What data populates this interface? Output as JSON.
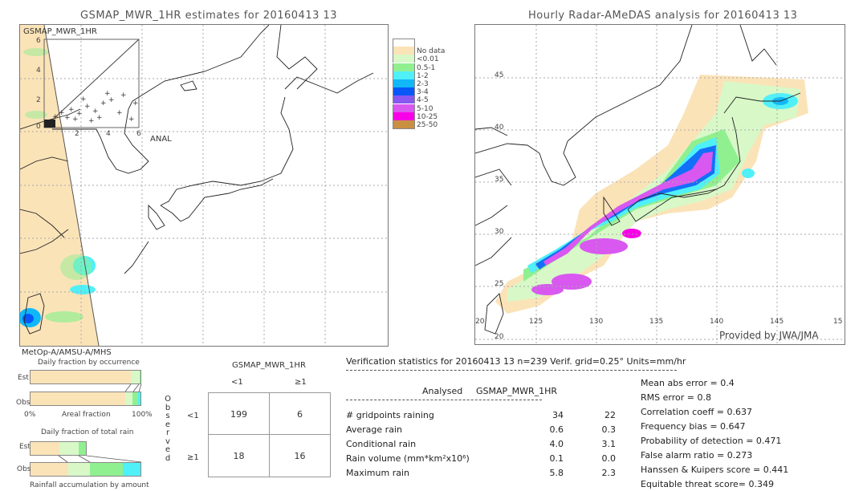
{
  "left_panel": {
    "title": "GSMAP_MWR_1HR estimates for 20160413 13",
    "inset_label": "GSMAP_MWR_1HR",
    "inset_y_ticks": [
      "6",
      "4",
      "2",
      "0"
    ],
    "inset_x_ticks": [
      "2",
      "4",
      "6"
    ],
    "anal_label": "ANAL",
    "satellite_label": "MetOp-A/AMSU-A/MHS"
  },
  "legend": {
    "items": [
      {
        "label": "",
        "color": "#ffffff"
      },
      {
        "label": "No data",
        "color": "#fbe3b8"
      },
      {
        "label": "<0.01",
        "color": "#d8f8c8"
      },
      {
        "label": "0.5-1",
        "color": "#90f090"
      },
      {
        "label": "1-2",
        "color": "#50f0f8"
      },
      {
        "label": "2-3",
        "color": "#10b8f8"
      },
      {
        "label": "3-4",
        "color": "#0858f8"
      },
      {
        "label": "4-5",
        "color": "#8858f0"
      },
      {
        "label": "5-10",
        "color": "#d858f0"
      },
      {
        "label": "10-25",
        "color": "#f800e8"
      },
      {
        "label": "25-50",
        "color": "#c89040"
      }
    ]
  },
  "right_panel": {
    "title": "Hourly Radar-AMeDAS analysis for 20160413 13",
    "lat_ticks": [
      "45",
      "40",
      "35",
      "30",
      "25",
      "20"
    ],
    "lon_ticks": [
      "20",
      "125",
      "130",
      "135",
      "140",
      "145",
      "15"
    ],
    "credit": "Provided by JWA/JMA"
  },
  "fraction_charts": {
    "occurrence_title": "Daily fraction by occurrence",
    "est_label": "Est",
    "obs_label": "Obs",
    "axis_left": "0%",
    "axis_mid": "Areal fraction",
    "axis_right": "100%",
    "occurrence_est": [
      {
        "color": "#fbe3b8",
        "fraction": 0.91
      },
      {
        "color": "#d8f8c8",
        "fraction": 0.08
      },
      {
        "color": "#90f090",
        "fraction": 0.01
      }
    ],
    "occurrence_obs": [
      {
        "color": "#fbe3b8",
        "fraction": 0.86
      },
      {
        "color": "#d8f8c8",
        "fraction": 0.07
      },
      {
        "color": "#90f090",
        "fraction": 0.05
      },
      {
        "color": "#50f0f8",
        "fraction": 0.02
      }
    ],
    "total_title": "Daily fraction of total rain",
    "total_est": [
      {
        "color": "#fbe3b8",
        "fraction": 0.52
      },
      {
        "color": "#d8f8c8",
        "fraction": 0.35
      },
      {
        "color": "#90f090",
        "fraction": 0.13
      }
    ],
    "total_obs": [
      {
        "color": "#fbe3b8",
        "fraction": 0.34
      },
      {
        "color": "#d8f8c8",
        "fraction": 0.2
      },
      {
        "color": "#90f090",
        "fraction": 0.3
      },
      {
        "color": "#50f0f8",
        "fraction": 0.16
      }
    ],
    "footer": "Rainfall accumulation by amount"
  },
  "contingency": {
    "title": "GSMAP_MWR_1HR",
    "col_headers": [
      "<1",
      "≥1"
    ],
    "row_headers": [
      "<1",
      "≥1"
    ],
    "side_label": [
      "O",
      "b",
      "s",
      "e",
      "r",
      "v",
      "e",
      "d"
    ],
    "cells": [
      [
        "199",
        "6"
      ],
      [
        "18",
        "16"
      ]
    ]
  },
  "verification": {
    "header": "Verification statistics for 20160413 13   n=239   Verif. grid=0.25°   Units=mm/hr",
    "col_analysed": "Analysed",
    "col_model": "GSMAP_MWR_1HR",
    "rows": [
      {
        "label": "# gridpoints raining",
        "analysed": "34",
        "model": "22"
      },
      {
        "label": "Average rain",
        "analysed": "0.6",
        "model": "0.3"
      },
      {
        "label": "Conditional rain",
        "analysed": "4.0",
        "model": "3.1"
      },
      {
        "label": "Rain volume (mm*km²x10⁶)",
        "analysed": "0.1",
        "model": "0.0"
      },
      {
        "label": "Maximum rain",
        "analysed": "5.8",
        "model": "2.3"
      }
    ],
    "scores": [
      "Mean abs error = 0.4",
      "RMS error = 0.8",
      "Correlation coeff = 0.637",
      "Frequency bias = 0.647",
      "Probability of detection = 0.471",
      "False alarm ratio = 0.273",
      "Hanssen & Kuipers score = 0.441",
      "Equitable threat score= 0.349"
    ]
  }
}
